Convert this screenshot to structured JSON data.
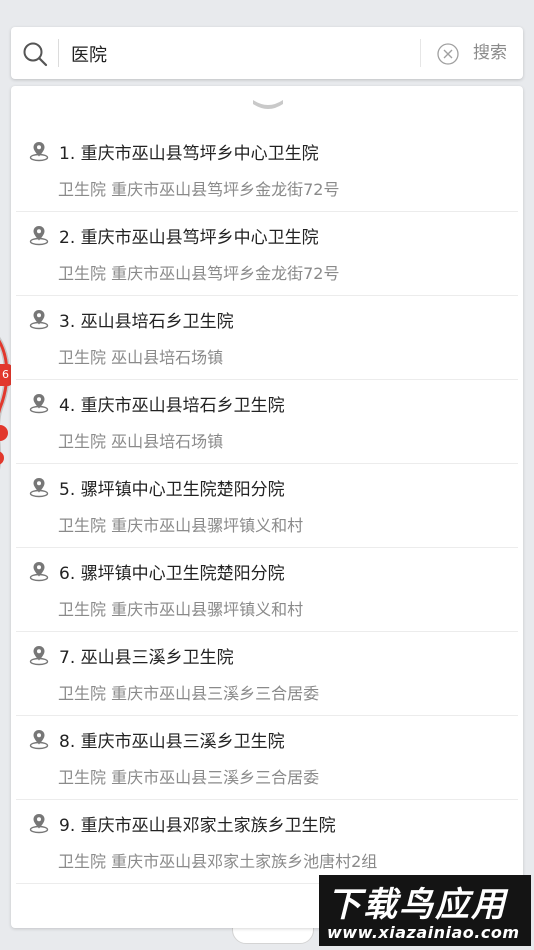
{
  "search": {
    "value": "医院",
    "search_label": "搜索"
  },
  "map": {
    "bubble_text": "6"
  },
  "results": [
    {
      "title": "1. 重庆市巫山县笃坪乡中心卫生院",
      "subtitle": "卫生院 重庆市巫山县笃坪乡金龙街72号"
    },
    {
      "title": "2. 重庆市巫山县笃坪乡中心卫生院",
      "subtitle": "卫生院 重庆市巫山县笃坪乡金龙街72号"
    },
    {
      "title": "3. 巫山县培石乡卫生院",
      "subtitle": "卫生院 巫山县培石场镇"
    },
    {
      "title": "4. 重庆市巫山县培石乡卫生院",
      "subtitle": "卫生院 巫山县培石场镇"
    },
    {
      "title": "5. 骡坪镇中心卫生院楚阳分院",
      "subtitle": "卫生院 重庆市巫山县骡坪镇义和村"
    },
    {
      "title": "6. 骡坪镇中心卫生院楚阳分院",
      "subtitle": "卫生院 重庆市巫山县骡坪镇义和村"
    },
    {
      "title": "7. 巫山县三溪乡卫生院",
      "subtitle": "卫生院 重庆市巫山县三溪乡三合居委"
    },
    {
      "title": "8. 重庆市巫山县三溪乡卫生院",
      "subtitle": "卫生院 重庆市巫山县三溪乡三合居委"
    },
    {
      "title": "9. 重庆市巫山县邓家土家族乡卫生院",
      "subtitle": "卫生院 重庆市巫山县邓家土家族乡池唐村2组"
    }
  ],
  "watermark": {
    "line1": "下载鸟应用",
    "line2": "www.xiazainiao.com"
  },
  "colors": {
    "accent_red": "#e2382d",
    "text_primary": "#222222",
    "text_secondary": "#8a8a8a"
  }
}
